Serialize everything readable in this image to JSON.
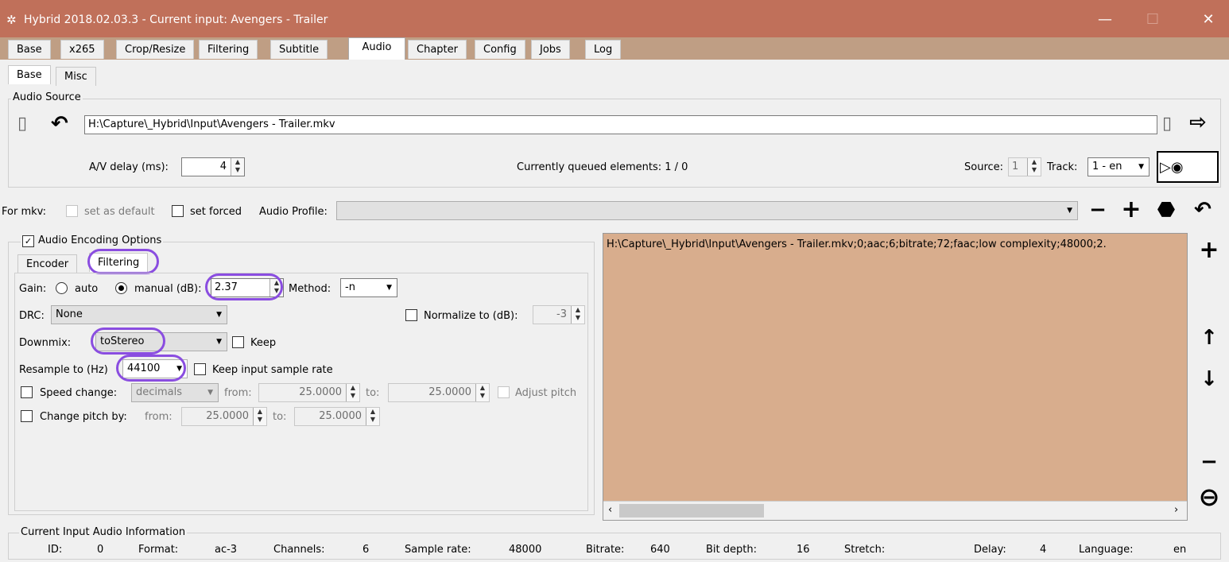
{
  "window": {
    "title": "Hybrid 2018.02.03.3 - Current input: Avengers - Trailer",
    "minimize": "—",
    "maximize": "☐",
    "close": "✕"
  },
  "main_tabs": [
    "Base",
    "x265",
    "Crop/Resize",
    "Filtering",
    "Subtitle",
    "Audio",
    "Chapter",
    "Config",
    "Jobs",
    "Log"
  ],
  "active_main_tab": "Audio",
  "sub_tabs": [
    "Base",
    "Misc"
  ],
  "audio_source": {
    "title": "Audio Source",
    "path": "H:\\Capture\\_Hybrid\\Input\\Avengers - Trailer.mkv",
    "av_delay_label": "A/V delay (ms):",
    "av_delay_value": "4",
    "queued_text": "Currently queued elements: 1 / 0",
    "source_label": "Source:",
    "source_value": "1",
    "track_label": "Track:",
    "track_value": "1 - en"
  },
  "mkv_row": {
    "for_mkv_label": "For mkv:",
    "set_default_label": "set as default",
    "set_forced_label": "set forced",
    "audio_profile_label": "Audio Profile:",
    "audio_profile_value": ""
  },
  "encoding": {
    "title": "Audio Encoding Options",
    "checked": true,
    "tabs": [
      "Encoder",
      "Filtering"
    ],
    "active_tab": "Filtering",
    "gain_label": "Gain:",
    "auto_label": "auto",
    "manual_label": "manual (dB):",
    "gain_value": "2.37",
    "method_label": "Method:",
    "method_value": "-n",
    "drc_label": "DRC:",
    "drc_value": "None",
    "normalize_label": "Normalize to (dB):",
    "normalize_value": "-3",
    "downmix_label": "Downmix:",
    "downmix_value": "toStereo",
    "keep_label": "Keep",
    "resample_label": "Resample to (Hz)",
    "resample_value": "44100",
    "keep_rate_label": "Keep input sample rate",
    "speed_label": "Speed change:",
    "speed_mode": "decimals",
    "from_label": "from:",
    "to_label": "to:",
    "speed_from": "25.0000",
    "speed_to": "25.0000",
    "adjust_pitch_label": "Adjust pitch",
    "pitch_label": "Change pitch by:",
    "pitch_from": "25.0000",
    "pitch_to": "25.0000"
  },
  "queue": {
    "items": [
      "H:\\Capture\\_Hybrid\\Input\\Avengers - Trailer.mkv;0;aac;6;bitrate;72;faac;low complexity;48000;2."
    ],
    "bg_color": "#d8ad8d"
  },
  "info": {
    "title": "Current Input Audio Information",
    "fields": [
      {
        "label": "ID:",
        "value": "0"
      },
      {
        "label": "Format:",
        "value": "ac-3"
      },
      {
        "label": "Channels:",
        "value": "6"
      },
      {
        "label": "Sample rate:",
        "value": "48000"
      },
      {
        "label": "Bitrate:",
        "value": "640"
      },
      {
        "label": "Bit depth:",
        "value": "16"
      },
      {
        "label": "Stretch:",
        "value": ""
      },
      {
        "label": "Delay:",
        "value": "4"
      },
      {
        "label": "Language:",
        "value": "en"
      }
    ]
  },
  "colors": {
    "title_bar": "#c0705a",
    "tab_strip": "#bf9e84",
    "highlight": "#8a4de0"
  }
}
